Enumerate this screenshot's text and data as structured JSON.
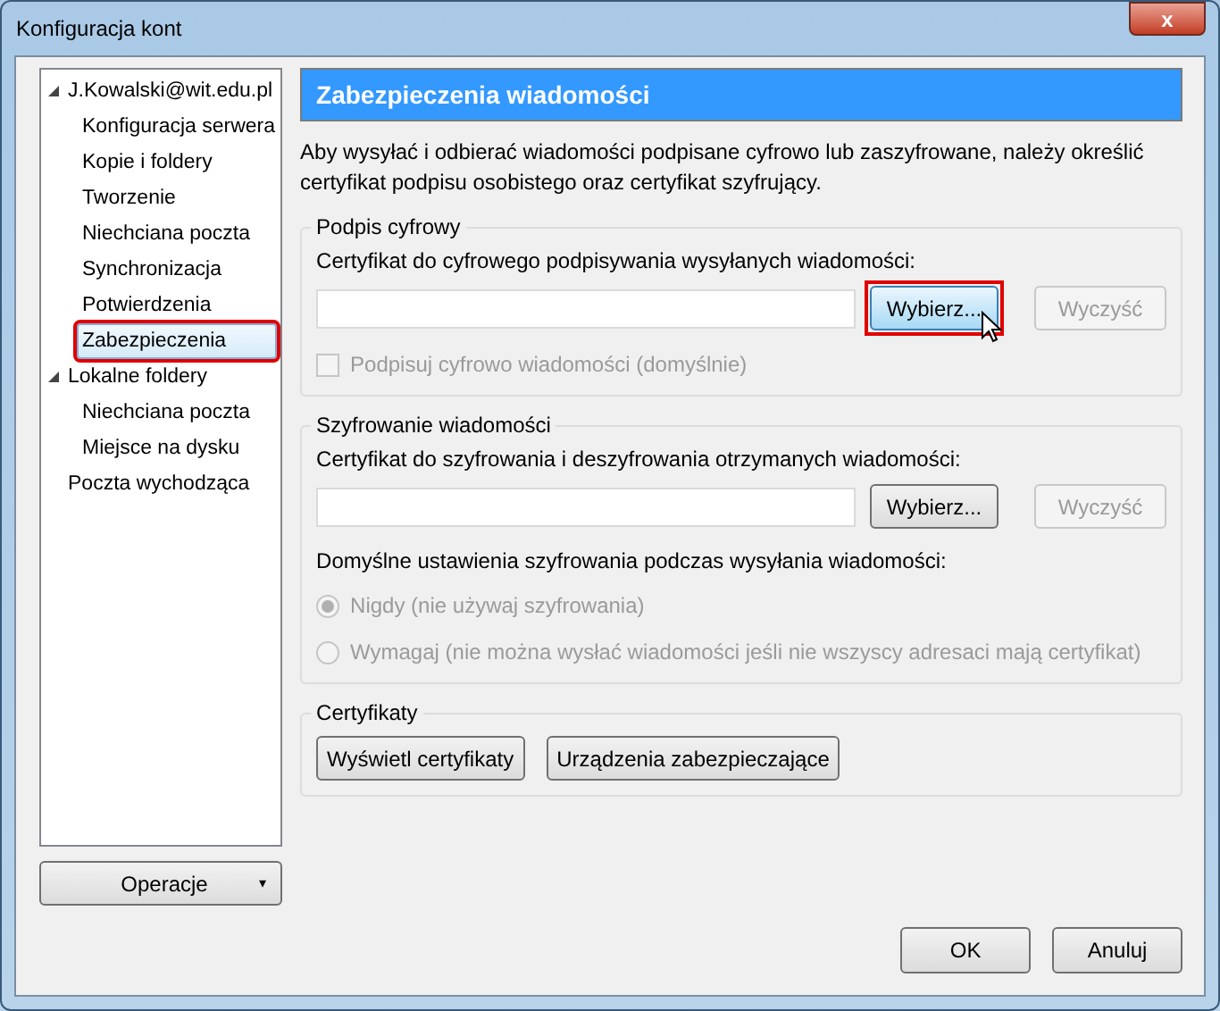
{
  "window": {
    "title": "Konfiguracja kont",
    "close_label": "x"
  },
  "tree": [
    {
      "label": "J.Kowalski@wit.edu.pl",
      "expanded": true,
      "selected": false,
      "highlighted": false,
      "children": [
        {
          "label": "Konfiguracja serwera",
          "selected": false,
          "highlighted": false
        },
        {
          "label": "Kopie i foldery",
          "selected": false,
          "highlighted": false
        },
        {
          "label": "Tworzenie",
          "selected": false,
          "highlighted": false
        },
        {
          "label": "Niechciana poczta",
          "selected": false,
          "highlighted": false
        },
        {
          "label": "Synchronizacja",
          "selected": false,
          "highlighted": false
        },
        {
          "label": "Potwierdzenia",
          "selected": false,
          "highlighted": false
        },
        {
          "label": "Zabezpieczenia",
          "selected": true,
          "highlighted": true
        }
      ]
    },
    {
      "label": "Lokalne foldery",
      "expanded": true,
      "selected": false,
      "highlighted": false,
      "children": [
        {
          "label": "Niechciana poczta",
          "selected": false,
          "highlighted": false
        },
        {
          "label": "Miejsce na dysku",
          "selected": false,
          "highlighted": false
        }
      ]
    },
    {
      "label": "Poczta wychodząca",
      "selected": false,
      "highlighted": false
    }
  ],
  "operations_button": {
    "label": "Operacje",
    "arrow": "▾"
  },
  "header": "Zabezpieczenia wiadomości",
  "description": "Aby wysyłać i odbierać wiadomości podpisane cyfrowo lub zaszyfrowane, należy określić certyfikat podpisu osobistego oraz certyfikat szyfrujący.",
  "signing": {
    "title": "Podpis cyfrowy",
    "label": "Certyfikat do cyfrowego podpisywania wysyłanych wiadomości:",
    "choose": {
      "label": "Wybierz...",
      "disabled": false,
      "highlighted": true,
      "hovered": true
    },
    "clear": {
      "label": "Wyczyść",
      "disabled": true
    },
    "checkbox": {
      "label": "Podpisuj cyfrowo wiadomości (domyślnie)",
      "checked": false,
      "disabled": true
    }
  },
  "encryption": {
    "title": "Szyfrowanie wiadomości",
    "label": "Certyfikat do szyfrowania i deszyfrowania otrzymanych wiadomości:",
    "choose": {
      "label": "Wybierz...",
      "disabled": false,
      "hovered": false
    },
    "clear": {
      "label": "Wyczyść",
      "disabled": true
    },
    "default_label": "Domyślne ustawienia szyfrowania podczas wysyłania wiadomości:",
    "options": [
      {
        "label": "Nigdy (nie używaj szyfrowania)",
        "selected": true,
        "disabled": true
      },
      {
        "label": "Wymagaj (nie można wysłać wiadomości jeśli nie wszyscy adresaci mają certyfikat)",
        "selected": false,
        "disabled": true
      }
    ]
  },
  "certificates": {
    "title": "Certyfikaty",
    "buttons": [
      "Wyświetl certyfikaty",
      "Urządzenia zabezpieczające"
    ]
  },
  "footer_buttons": [
    "OK",
    "Anuluj"
  ]
}
